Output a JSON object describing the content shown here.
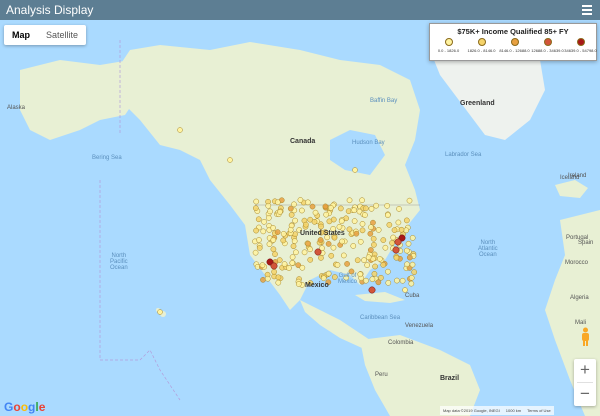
{
  "app": {
    "title": "Analysis Display"
  },
  "map_type": {
    "options": [
      "Map",
      "Satellite"
    ],
    "selected": "Map"
  },
  "legend": {
    "title": "$75K+ Income Qualified 85+ FY",
    "items": [
      {
        "label": "0.0 - 1826.0",
        "color": "#fff3a0"
      },
      {
        "label": "1826.0 - 8146.0",
        "color": "#f5d36a"
      },
      {
        "label": "8146.0 - 12688.0",
        "color": "#e8a040"
      },
      {
        "label": "12688.0 - 34639.0",
        "color": "#d2553a"
      },
      {
        "label": "34639.0 - 54798.0",
        "color": "#a81818"
      }
    ]
  },
  "places": {
    "canada": "Canada",
    "united_states": "United States",
    "mexico": "Mexico",
    "greenland": "Greenland",
    "iceland": "Iceland",
    "hudson_bay": "Hudson Bay",
    "baffin_bay": "Baffin Bay",
    "labrador_sea": "Labrador Sea",
    "bering_sea": "Bering Sea",
    "gulf_of_mexico": "Gulf of\nMexico",
    "caribbean_sea": "Caribbean Sea",
    "north_pacific_ocean": "North\nPacific\nOcean",
    "north_atlantic_ocean": "North\nAtlantic\nOcean",
    "venezuela": "Venezuela",
    "colombia": "Colombia",
    "peru": "Peru",
    "brazil": "Brazil",
    "spain": "Spain",
    "portugal": "Portugal",
    "morocco": "Morocco",
    "algeria": "Algeria",
    "mali": "Mali",
    "cuba": "Cuba",
    "ireland": "Ireland",
    "alaska": "Alaska"
  },
  "map_controls": {
    "zoom_in": "+",
    "zoom_out": "−"
  },
  "footer": {
    "attribution": "Map data ©2019 Google, INEGI",
    "scale": "1000 km",
    "terms": "Terms of Use"
  },
  "google_logo": "Google",
  "colors": {
    "water": "#aadaff",
    "land": "#e8f0d4",
    "topbar": "#5d7e93"
  }
}
